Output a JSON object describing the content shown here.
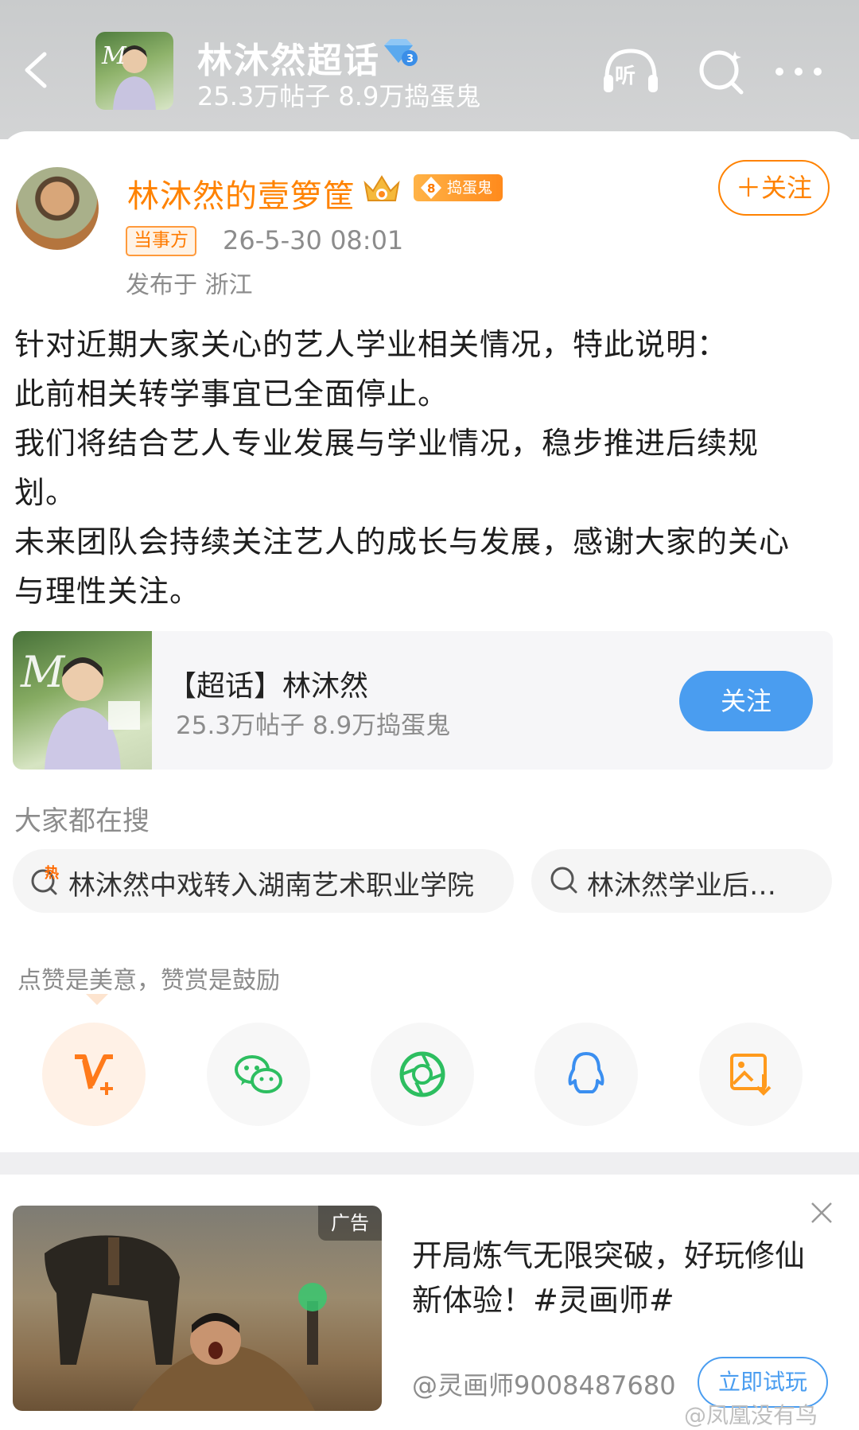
{
  "header": {
    "topic_title": "林沐然超话",
    "topic_stats": "25.3万帖子 8.9万捣蛋鬼",
    "listen_icon_label": "听",
    "icons": [
      "back-icon",
      "headphone-listen-icon",
      "search-icon",
      "more-icon"
    ]
  },
  "post": {
    "author_name": "林沐然的壹箩筐",
    "fan_level": "8",
    "fan_badge_label": "捣蛋鬼",
    "follow_label": "＋关注",
    "party_tag": "当事方",
    "timestamp": "26-5-30 08:01",
    "location": "发布于 浙江",
    "body_lines": [
      "针对近期大家关心的艺人学业相关情况，特此说明：",
      "此前相关转学事宜已全面停止。",
      "我们将结合艺人专业发展与学业情况，稳步推进后续规",
      "划。",
      "未来团队会持续关注艺人的成长与发展，感谢大家的关心",
      "与理性关注。"
    ]
  },
  "topic_card": {
    "title": "【超话】林沐然",
    "stats": "25.3万帖子 8.9万捣蛋鬼",
    "follow_label": "关注"
  },
  "search": {
    "heading": "大家都在搜",
    "hot_badge": "热",
    "suggestions": [
      "林沐然中戏转入湖南艺术职业学院",
      "林沐然学业后…"
    ]
  },
  "share": {
    "prompt": "点赞是美意，赞赏是鼓励",
    "buttons": [
      "reward-icon",
      "wechat-icon",
      "moments-icon",
      "qq-icon",
      "save-image-icon"
    ]
  },
  "ad": {
    "tag": "广告",
    "title": "开局炼气无限突破，好玩修仙新体验！#灵画师#",
    "account": "@灵画师9008487680",
    "cta": "立即试玩"
  },
  "watermark": "@凤凰没有鸟",
  "colors": {
    "accent_orange": "#ff8200",
    "accent_blue": "#4a9df0",
    "header_bg": "#cbcdce"
  }
}
